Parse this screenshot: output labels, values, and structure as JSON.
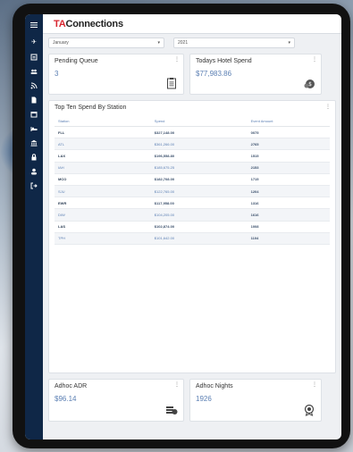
{
  "app": {
    "logo_ta": "TA",
    "logo_rest": "Connections"
  },
  "sidebar": {
    "icons": [
      "menu-icon",
      "plane-icon",
      "list-icon",
      "people-icon",
      "rss-icon",
      "document-icon",
      "calendar-icon",
      "bed-icon",
      "bank-icon",
      "lock-icon",
      "user-icon",
      "signout-icon"
    ]
  },
  "filters": {
    "month": "January",
    "year": "2021"
  },
  "cards": {
    "pending": {
      "title": "Pending Queue",
      "value": "3"
    },
    "hotel": {
      "title": "Todays Hotel Spend",
      "value": "$77,983.86"
    },
    "adr": {
      "title": "Adhoc ADR",
      "value": "$96.14"
    },
    "nights": {
      "title": "Adhoc Nights",
      "value": "1926"
    }
  },
  "table": {
    "title": "Top Ten Spend By Station",
    "headers": [
      "Station",
      "Spend",
      "Event Amount"
    ],
    "rows": [
      {
        "station": "FLL",
        "spend": "$327,148.00",
        "count": "0075"
      },
      {
        "station": "ATL",
        "spend": "$361,266.00",
        "count": "2765"
      },
      {
        "station": "LAX",
        "spend": "$196,558.80",
        "count": "1515"
      },
      {
        "station": "IAH",
        "spend": "$185,675.25",
        "count": "2153"
      },
      {
        "station": "MCO",
        "spend": "$182,708.00",
        "count": "1715"
      },
      {
        "station": "SJU",
        "spend": "$122,765.00",
        "count": "1204"
      },
      {
        "station": "EWR",
        "spend": "$117,958.00",
        "count": "1316"
      },
      {
        "station": "DIW",
        "spend": "$104,205.00",
        "count": "1616"
      },
      {
        "station": "LAS",
        "spend": "$102,874.00",
        "count": "1008"
      },
      {
        "station": "TPH",
        "spend": "$101,642.00",
        "count": "1104"
      }
    ]
  },
  "colors": {
    "sidebar": "#0f2747",
    "accent": "#5b7fb3",
    "brand_red": "#d8262f"
  }
}
